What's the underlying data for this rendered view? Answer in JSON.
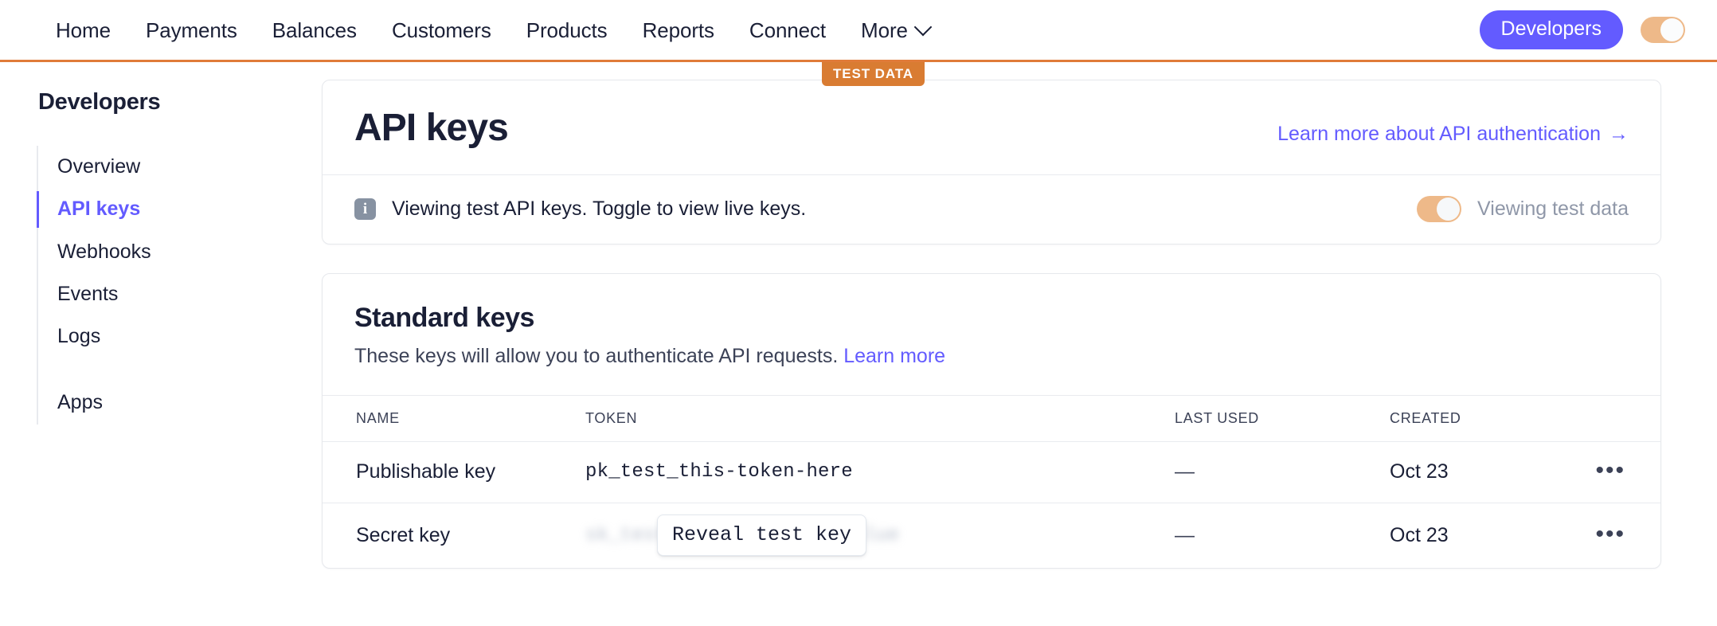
{
  "topnav": {
    "links": [
      {
        "label": "Home"
      },
      {
        "label": "Payments"
      },
      {
        "label": "Balances"
      },
      {
        "label": "Customers"
      },
      {
        "label": "Products"
      },
      {
        "label": "Reports"
      },
      {
        "label": "Connect"
      },
      {
        "label": "More"
      }
    ],
    "developers_button": "Developers",
    "accent_purple": "#635bff",
    "toggle_color": "#eeb989",
    "underline_color": "#e07b39"
  },
  "test_badge": {
    "label": "TEST DATA",
    "bg": "#d97c32"
  },
  "sidebar": {
    "title": "Developers",
    "items": [
      {
        "label": "Overview",
        "active": false
      },
      {
        "label": "API keys",
        "active": true
      },
      {
        "label": "Webhooks",
        "active": false
      },
      {
        "label": "Events",
        "active": false
      },
      {
        "label": "Logs",
        "active": false
      }
    ],
    "secondary_items": [
      {
        "label": "Apps",
        "active": false
      }
    ]
  },
  "header_card": {
    "title": "API keys",
    "learn_link": "Learn more about API authentication",
    "learn_link_arrow": "→",
    "banner": {
      "icon": "info-icon",
      "icon_glyph": "i",
      "text": "Viewing test API keys. Toggle to view live keys.",
      "toggle_state": "on",
      "toggle_label": "Viewing test data"
    }
  },
  "standard_keys": {
    "title": "Standard keys",
    "description": "These keys will allow you to authenticate API requests.",
    "description_link": "Learn more",
    "columns": [
      "NAME",
      "TOKEN",
      "LAST USED",
      "CREATED"
    ],
    "rows": [
      {
        "name": "Publishable key",
        "token": "pk_test_this-token-here",
        "token_hidden": false,
        "last_used": "—",
        "created": "Oct 23",
        "menu": "•••"
      },
      {
        "name": "Secret key",
        "token": "sk_test_hidden-secret-value",
        "token_hidden": true,
        "reveal_label": "Reveal test key",
        "last_used": "—",
        "created": "Oct 23",
        "menu": "•••"
      }
    ]
  }
}
